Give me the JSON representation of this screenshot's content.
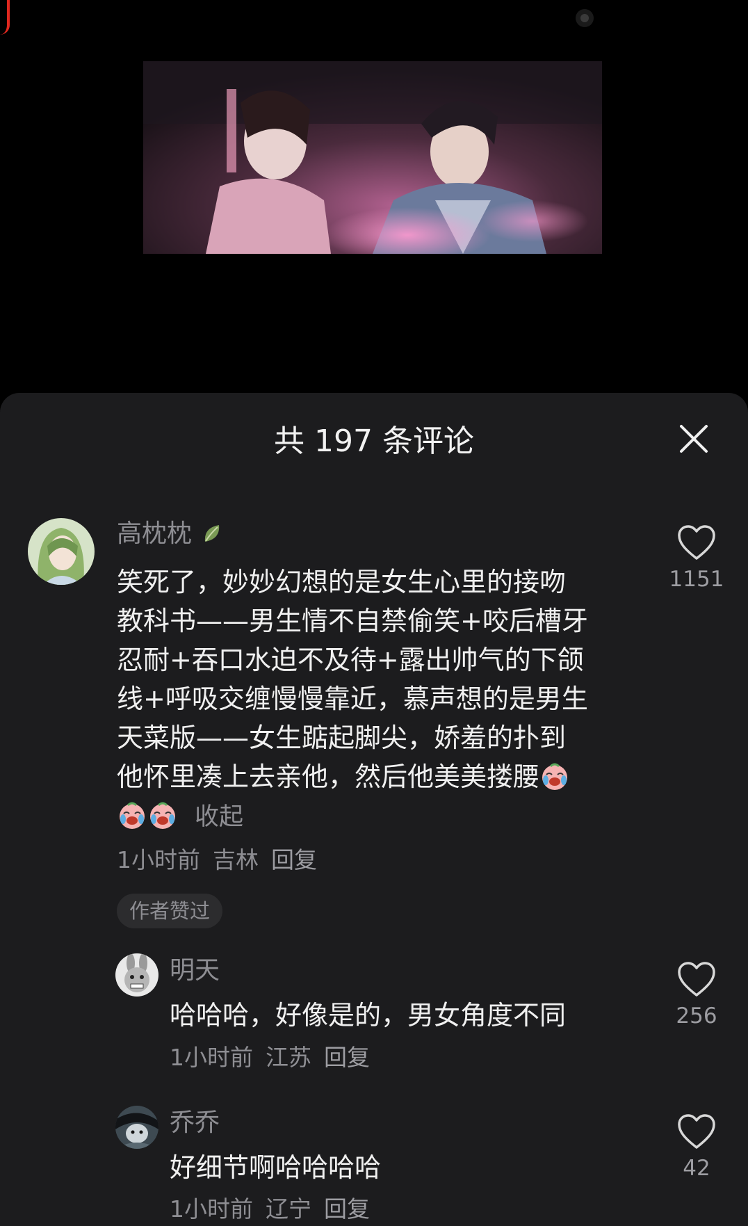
{
  "sheet": {
    "title": "共 197 条评论"
  },
  "comments": [
    {
      "username": "高枕枕",
      "badge_icon": "leaf-icon",
      "text_lines": [
        "笑死了，妙妙幻想的是女生心里的接吻",
        "教科书——男生情不自禁偷笑+咬后槽牙",
        "忍耐+吞口水迫不及待+露出帅气的下颌",
        "线+呼吸交缠慢慢靠近，慕声想的是男生",
        "天菜版——女生踮起脚尖，娇羞的扑到",
        "他怀里凑上去亲他，然后他美美搂腰"
      ],
      "emoji": "crying-face-emoji",
      "collapse_label": "收起",
      "time": "1小时前",
      "location": "吉林",
      "reply_label": "回复",
      "author_badge": "作者赞过",
      "likes": "1151"
    },
    {
      "username": "明天",
      "text": "哈哈哈，好像是的，男女角度不同",
      "time": "1小时前",
      "location": "江苏",
      "reply_label": "回复",
      "likes": "256"
    },
    {
      "username": "乔乔",
      "text": "好细节啊哈哈哈哈",
      "time": "1小时前",
      "location": "辽宁",
      "reply_label": "回复",
      "likes": "42"
    }
  ],
  "colors": {
    "background": "#000000",
    "sheet": "#1c1c1e",
    "text_primary": "#f0f0f0",
    "text_secondary": "#8e8e93",
    "accent_red": "#e0281f"
  }
}
